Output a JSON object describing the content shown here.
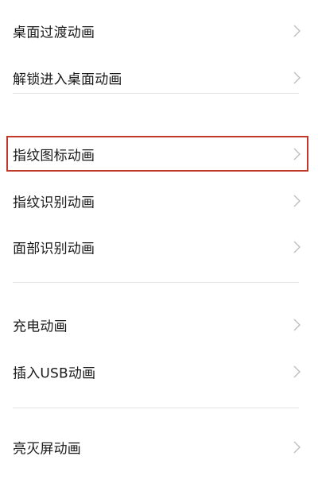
{
  "settings": {
    "items": [
      {
        "label": "桌面过渡动画"
      },
      {
        "label": "解锁进入桌面动画"
      },
      {
        "label": "指纹图标动画"
      },
      {
        "label": "指纹识别动画"
      },
      {
        "label": "面部识别动画"
      },
      {
        "label": "充电动画"
      },
      {
        "label": "插入USB动画"
      },
      {
        "label": "亮灭屏动画"
      }
    ]
  },
  "colors": {
    "highlight_border": "#c0392b",
    "chevron": "#bdbdbd",
    "separator": "#e4e4e4"
  },
  "icons": {
    "chevron": "chevron-right-icon"
  }
}
